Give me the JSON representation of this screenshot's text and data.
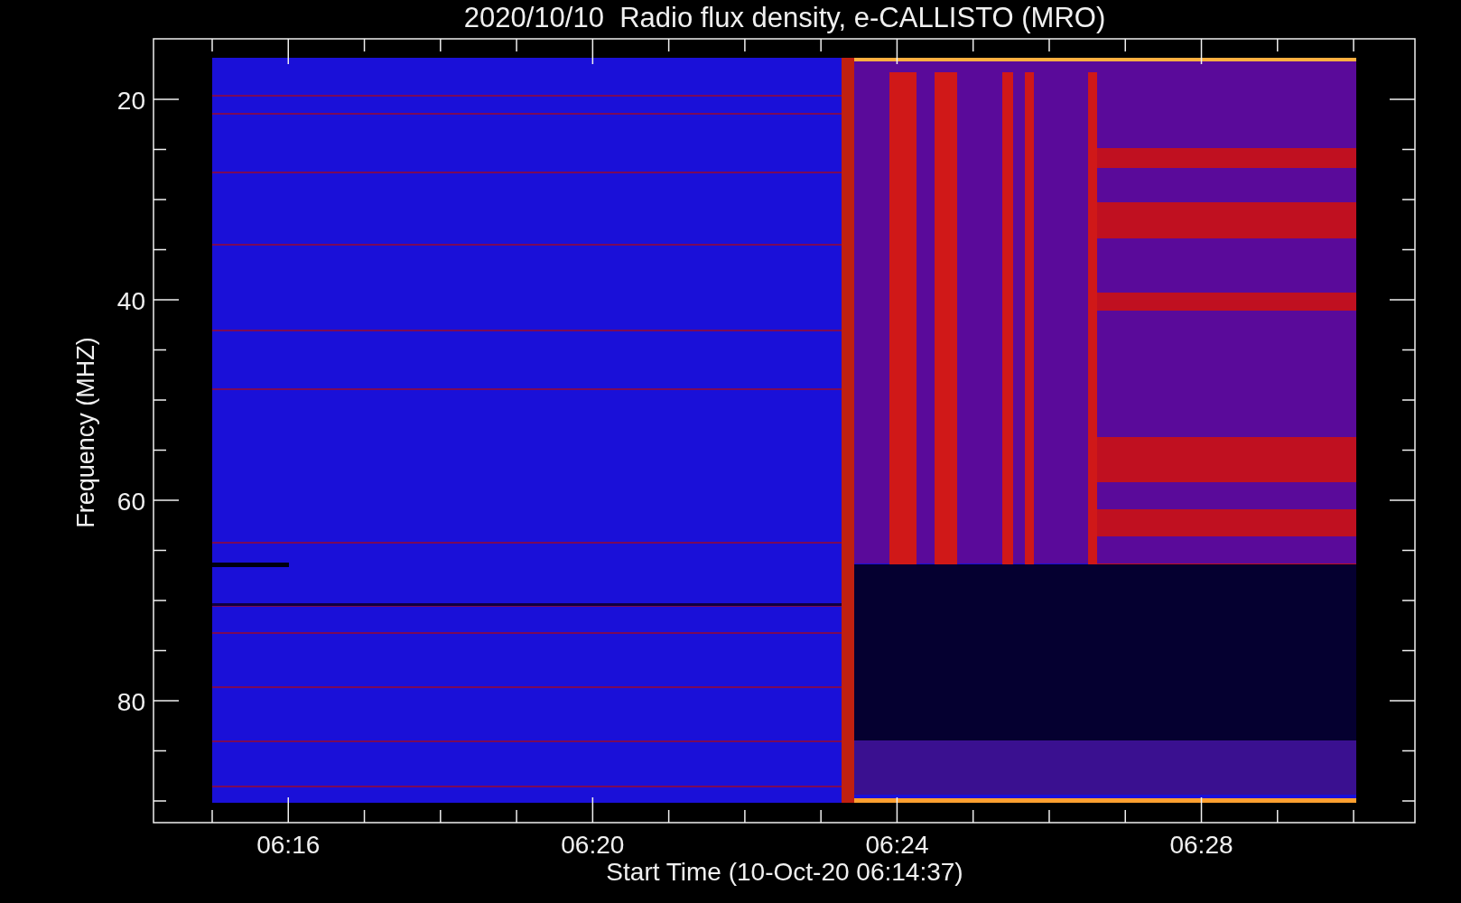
{
  "plot": {
    "title": "2020/10/10  Radio flux density, e-CALLISTO (MRO)",
    "ylabel": "Frequency (MHZ)",
    "yticks": [
      "20",
      "40",
      "60",
      "80"
    ],
    "xticks": [
      "06:16",
      "06:20",
      "06:24",
      "06:28"
    ],
    "xlabel": "Start Time (10-Oct-20 06:14:37)"
  }
}
